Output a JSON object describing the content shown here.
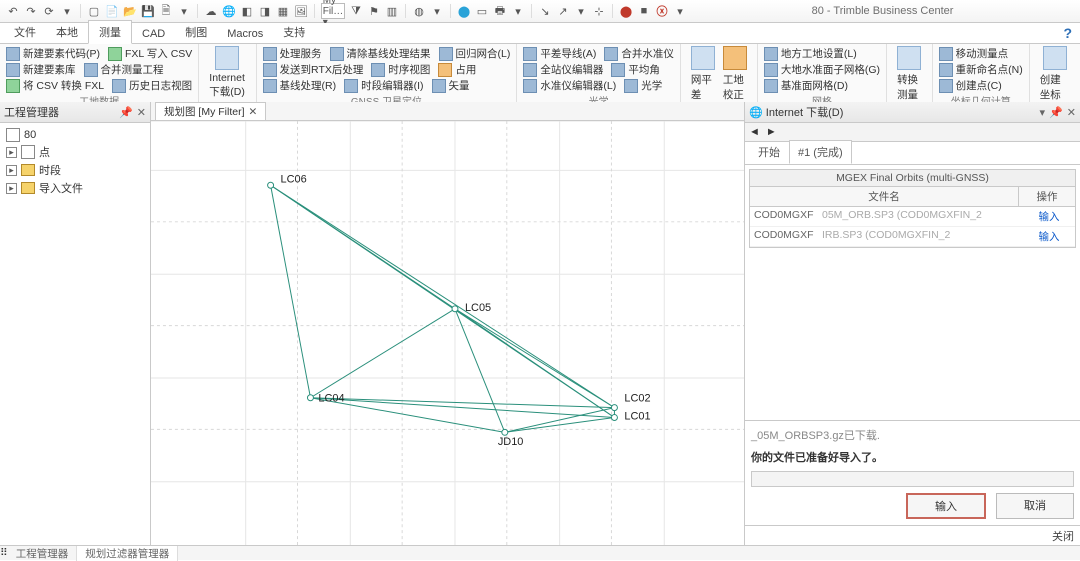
{
  "app": {
    "title": "80 - Trimble Business Center"
  },
  "menu": {
    "tabs": [
      "文件",
      "本地",
      "测量",
      "CAD",
      "制图",
      "Macros",
      "支持"
    ],
    "active": 2
  },
  "ribbon": {
    "g1": {
      "title": "工地数据",
      "items": [
        "新建要素代码(P)",
        "新建要素库",
        "将 CSV 转换 FXL",
        "FXL 写入 CSV",
        "合并测量工程",
        "历史日志视图"
      ]
    },
    "g2": {
      "label": "Internet 下载(D)"
    },
    "g3": {
      "title": "GNSS 卫星定位",
      "items": [
        "处理服务",
        "发送到RTX后处理",
        "基线处理(R)",
        "清除基线处理结果",
        "时序视图",
        "时段编辑器(I)",
        "回归网合(L)",
        "占用",
        "矢量"
      ]
    },
    "g4": {
      "title": "光学",
      "items": [
        "平差导线(A)",
        "全站仪编辑器",
        "水准仪编辑器(L)",
        "合并水准仪",
        "平均角",
        "光学"
      ]
    },
    "g5": {
      "label1": "网平差(A)",
      "label2": "工地校正(C)"
    },
    "g6": {
      "title": "网格",
      "items": [
        "地方工地设置(L)",
        "大地水准面子网格(G)",
        "基准面网格(D)"
      ]
    },
    "g7": {
      "label": "转换测量点"
    },
    "g8": {
      "title": "坐标几何计算",
      "items": [
        "移动测量点",
        "重新命名点(N)",
        "创建点(C)",
        "创建坐标几何"
      ]
    }
  },
  "explorer": {
    "title": "工程管理器",
    "nodes": [
      {
        "label": "80",
        "icon": "doc"
      },
      {
        "label": "点",
        "icon": "doc",
        "expander": "▸"
      },
      {
        "label": "时段",
        "icon": "fold",
        "expander": "▸"
      },
      {
        "label": "导入文件",
        "icon": "fold",
        "expander": "▸"
      }
    ]
  },
  "doc": {
    "tab": "规划图 [My Filter]"
  },
  "points": {
    "LC06": "LC06",
    "LC05": "LC05",
    "LC04": "LC04",
    "LC02": "LC02",
    "LC01": "LC01",
    "JD10": "JD10"
  },
  "dock": {
    "title": "Internet 下载(D)",
    "tabs": [
      "开始",
      "#1 (完成)"
    ],
    "group": "MGEX Final Orbits (multi-GNSS)",
    "col_name": "文件名",
    "col_op": "操作",
    "rows": [
      {
        "name": "COD0MGXF",
        "detail": "05M_ORB.SP3  (COD0MGXFIN_2",
        "op": "输入"
      },
      {
        "name": "COD0MGXF",
        "detail": "IRB.SP3  (COD0MGXFIN_2",
        "op": "输入"
      }
    ],
    "msg1": "_05M_ORBSP3.gz已下载.",
    "msg2": "你的文件已准备好导入了。",
    "btn_import": "输入",
    "btn_cancel": "取消",
    "btn_close": "关闭"
  },
  "status": {
    "tabs": [
      "工程管理器",
      "规划过滤器管理器"
    ]
  }
}
